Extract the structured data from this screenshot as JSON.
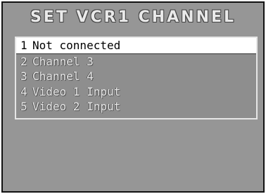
{
  "screen": {
    "title": "SET VCR1 CHANNEL"
  },
  "menu": {
    "selected_index": 0,
    "items": [
      {
        "number": "1",
        "label": "Not connected"
      },
      {
        "number": "2",
        "label": "Channel 3"
      },
      {
        "number": "3",
        "label": "Channel 4"
      },
      {
        "number": "4",
        "label": "Video 1 Input"
      },
      {
        "number": "5",
        "label": "Video 2 Input"
      }
    ]
  }
}
